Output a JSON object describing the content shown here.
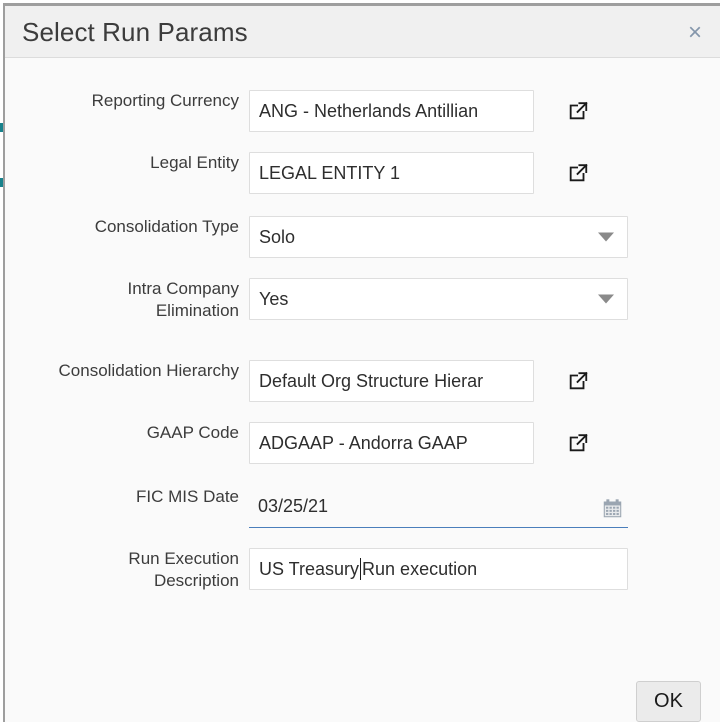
{
  "dialog": {
    "title": "Select Run Params",
    "close_label": "×",
    "close_icon": "close-icon"
  },
  "form": {
    "fields": [
      {
        "id": "reporting-currency",
        "label": "Reporting Currency",
        "label_line2": "",
        "value": "ANG - Netherlands Antillian",
        "control": "lov",
        "icon": "external-link-icon"
      },
      {
        "id": "legal-entity",
        "label": "Legal Entity",
        "label_line2": "",
        "value": "LEGAL ENTITY 1",
        "control": "lov",
        "icon": "external-link-icon"
      },
      {
        "id": "consolidation-type",
        "label": "Consolidation Type",
        "label_line2": "",
        "value": "Solo",
        "control": "dropdown",
        "icon": "chevron-down-icon"
      },
      {
        "id": "intra-company-elimination",
        "label": "Intra Company",
        "label_line2": "Elimination",
        "value": "Yes",
        "control": "dropdown",
        "icon": "chevron-down-icon"
      },
      {
        "id": "consolidation-hierarchy",
        "label": "Consolidation Hierarchy",
        "label_line2": "",
        "value": "Default Org Structure Hierar",
        "control": "lov",
        "icon": "external-link-icon"
      },
      {
        "id": "gaap-code",
        "label": "GAAP Code",
        "label_line2": "",
        "value": "ADGAAP -  Andorra GAAP",
        "control": "lov",
        "icon": "external-link-icon"
      },
      {
        "id": "fic-mis-date",
        "label": "FIC MIS Date",
        "label_line2": "",
        "value": "03/25/21",
        "control": "date",
        "icon": "calendar-icon"
      },
      {
        "id": "run-execution-description",
        "label": "Run Execution",
        "label_line2": "Description",
        "value_before_caret": "US Treasury ",
        "value_after_caret": "Run execution",
        "value": "US Treasury Run execution",
        "control": "text",
        "icon": ""
      }
    ]
  },
  "footer": {
    "ok_label": "OK"
  },
  "colors": {
    "header_bg": "#f0f0f0",
    "body_bg": "#fafafa",
    "border": "#9e9e9e",
    "input_border": "#dedede",
    "date_underline": "#4a7ebb",
    "close_icon": "#8496ab",
    "background_mark": "#18828c",
    "ok_bg": "#ebebeb"
  }
}
